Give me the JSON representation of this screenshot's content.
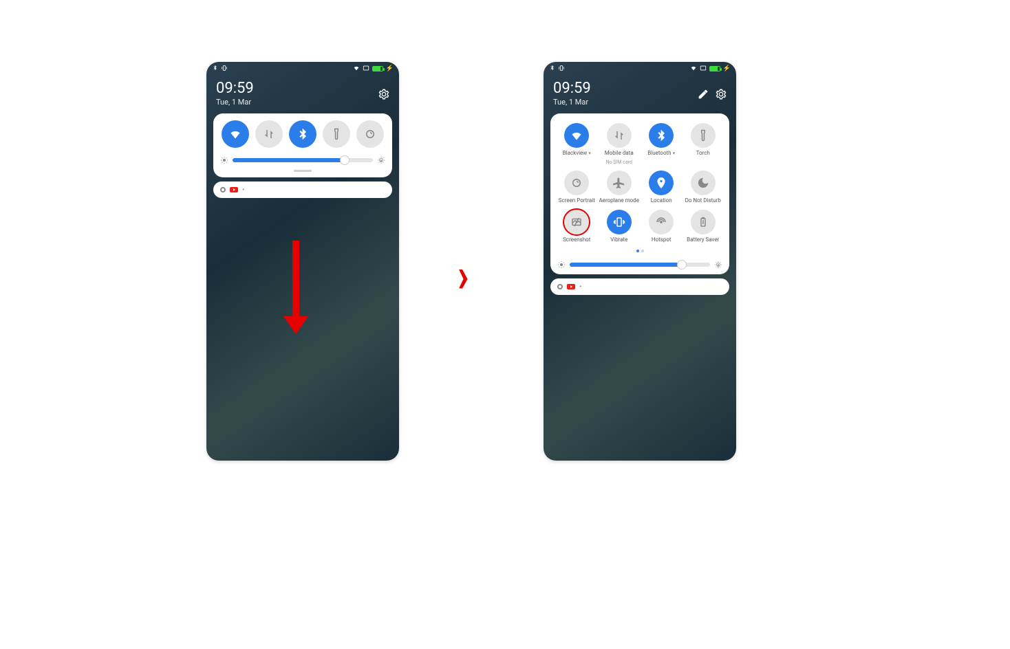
{
  "statusbar": {
    "bt_icon": "bluetooth",
    "vib_icon": "vibrate"
  },
  "header": {
    "time": "09:59",
    "date": "Tue, 1 Mar"
  },
  "collapsed_toggles": [
    {
      "id": "wifi",
      "name": "wifi-icon",
      "on": true
    },
    {
      "id": "data",
      "name": "data-icon",
      "on": false
    },
    {
      "id": "bt",
      "name": "bluetooth-icon",
      "on": true
    },
    {
      "id": "torch",
      "name": "torch-icon",
      "on": false
    },
    {
      "id": "rotate",
      "name": "rotate-lock-icon",
      "on": false
    }
  ],
  "brightness_pct": 80,
  "expanded_tiles": [
    {
      "id": "wifi",
      "name": "wifi-icon",
      "on": true,
      "label": "Blackview",
      "chevron": true
    },
    {
      "id": "data",
      "name": "data-icon",
      "on": false,
      "label": "Mobile data",
      "sub": "No SIM card"
    },
    {
      "id": "bt",
      "name": "bluetooth-icon",
      "on": true,
      "label": "Bluetooth",
      "chevron": true
    },
    {
      "id": "torch",
      "name": "torch-icon",
      "on": false,
      "label": "Torch"
    },
    {
      "id": "rotate",
      "name": "rotate-lock-icon",
      "on": false,
      "label": "Screen Portrait"
    },
    {
      "id": "airplane",
      "name": "airplane-icon",
      "on": false,
      "label": "Aeroplane mode"
    },
    {
      "id": "location",
      "name": "location-icon",
      "on": true,
      "label": "Location"
    },
    {
      "id": "dnd",
      "name": "dnd-icon",
      "on": false,
      "label": "Do Not Disturb"
    },
    {
      "id": "screenshot",
      "name": "screenshot-icon",
      "on": false,
      "label": "Screenshot",
      "highlight": true
    },
    {
      "id": "vibrate",
      "name": "vibrate-icon",
      "on": true,
      "label": "Vibrate"
    },
    {
      "id": "hotspot",
      "name": "hotspot-icon",
      "on": false,
      "label": "Hotspot"
    },
    {
      "id": "battery",
      "name": "battery-saver-icon",
      "on": false,
      "label": "Battery Saver"
    }
  ],
  "pager": {
    "active": 0,
    "count": 2
  },
  "notification_dot": "•"
}
